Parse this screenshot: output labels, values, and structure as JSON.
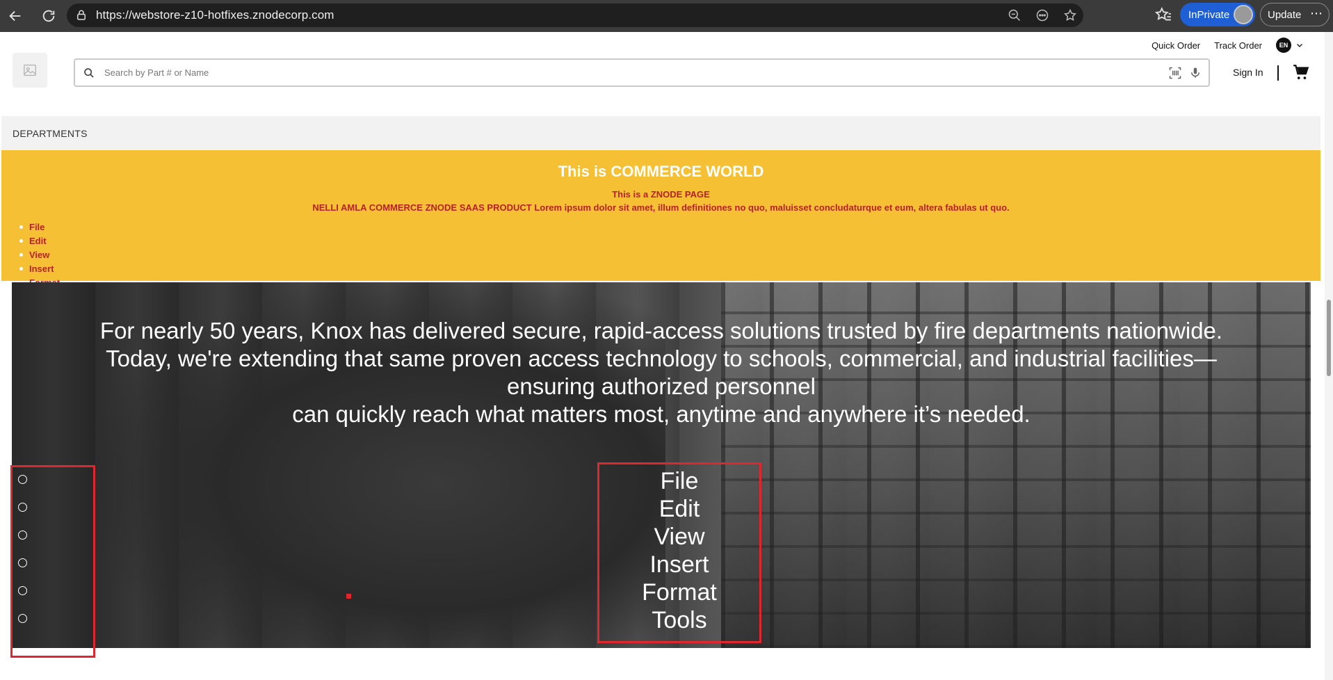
{
  "browser": {
    "url": "https://webstore-z10-hotfixes.znodecorp.com",
    "inprivate_label": "InPrivate",
    "update_label": "Update"
  },
  "header": {
    "quick_order": "Quick Order",
    "track_order": "Track Order",
    "language": "EN",
    "search_placeholder": "Search by Part # or Name",
    "sign_in": "Sign In"
  },
  "nav": {
    "departments": "DEPARTMENTS"
  },
  "banner": {
    "title": "This is COMMERCE WORLD",
    "subtitle": "This is a ZNODE PAGE",
    "description": "NELLI AMLA COMMERCE ZNODE SAAS PRODUCT Lorem ipsum dolor sit amet, illum definitiones no quo, maluisset concludaturque et eum, altera fabulas ut quo.",
    "menu": [
      "File",
      "Edit",
      "View",
      "Insert",
      "Format"
    ]
  },
  "hero": {
    "lines": [
      "For nearly 50 years, Knox has delivered secure, rapid-access solutions trusted by fire departments nationwide.",
      "Today, we're extending that same proven access technology to schools, commercial, and industrial facilities—",
      "ensuring authorized personnel",
      "can quickly reach what matters most, anytime and anywhere it’s needed."
    ],
    "menu": [
      "File",
      "Edit",
      "View",
      "Insert",
      "Format",
      "Tools"
    ]
  },
  "colors": {
    "banner_bg": "#f5c033",
    "banner_text": "#b8202a",
    "highlight_border": "#e0262e",
    "inprivate_bg": "#1e5fd6"
  }
}
